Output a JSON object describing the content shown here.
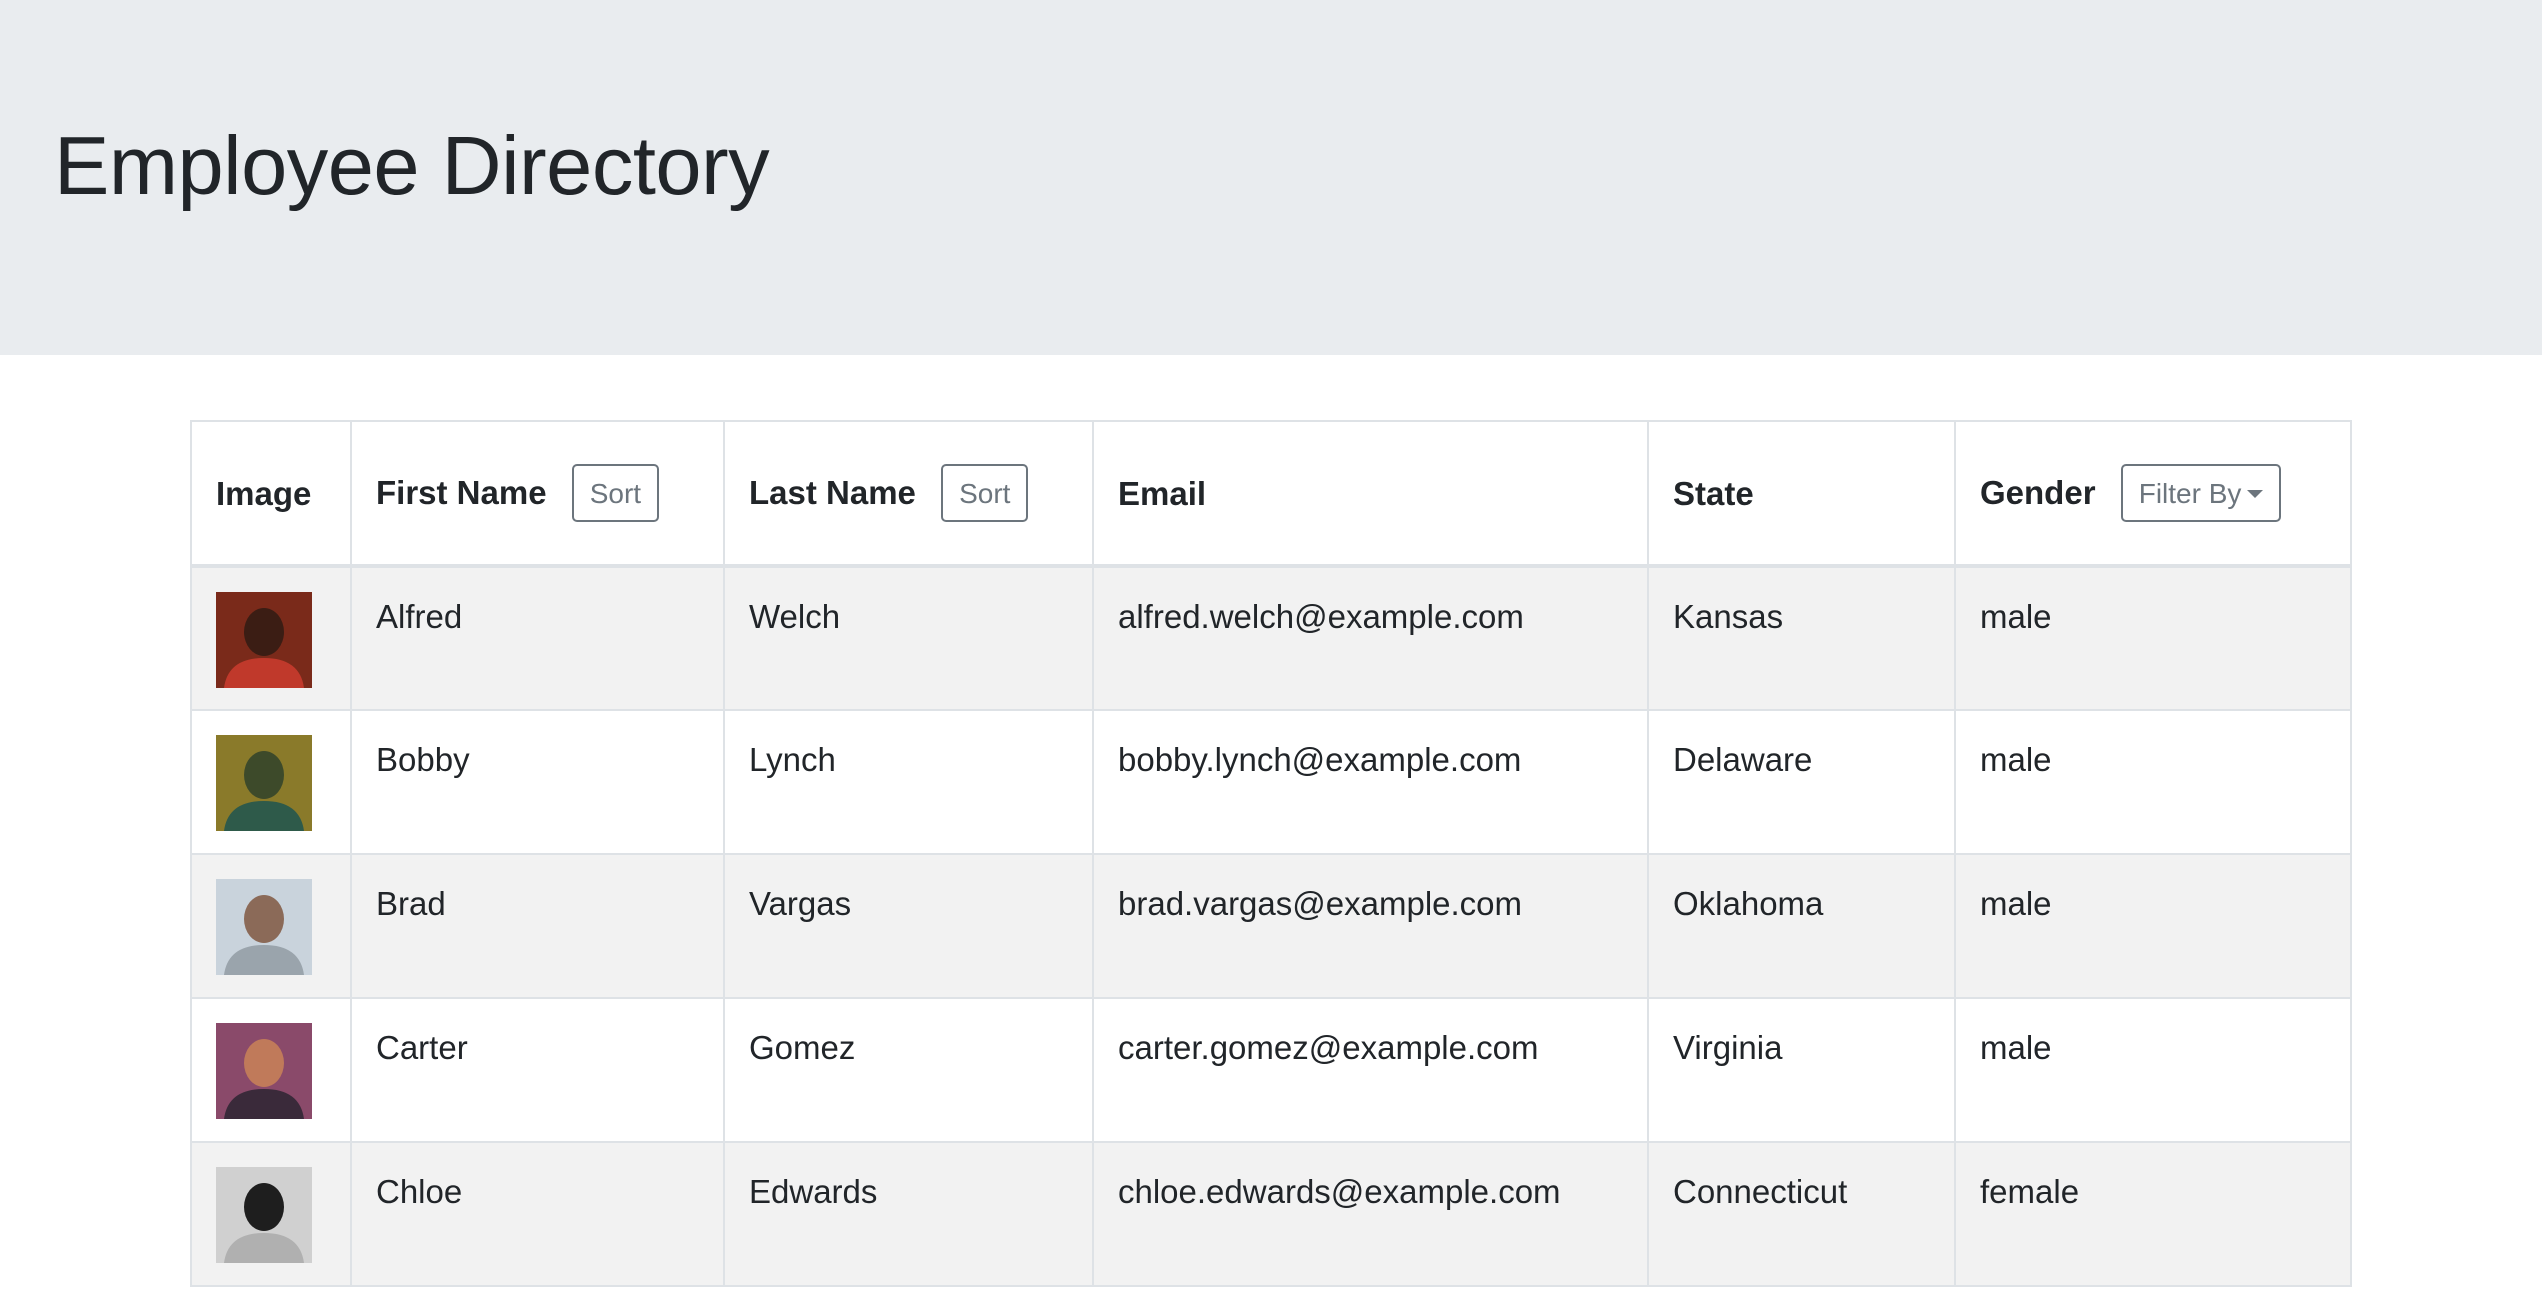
{
  "header": {
    "title": "Employee Directory"
  },
  "table": {
    "columns": {
      "image": "Image",
      "first_name": "First Name",
      "last_name": "Last Name",
      "email": "Email",
      "state": "State",
      "gender": "Gender"
    },
    "sort_label": "Sort",
    "filter_label": "Filter By",
    "rows": [
      {
        "first": "Alfred",
        "last": "Welch",
        "email": "alfred.welch@example.com",
        "state": "Kansas",
        "gender": "male",
        "avatar_colors": [
          "#7a2a1a",
          "#3b1d14",
          "#c0392b"
        ]
      },
      {
        "first": "Bobby",
        "last": "Lynch",
        "email": "bobby.lynch@example.com",
        "state": "Delaware",
        "gender": "male",
        "avatar_colors": [
          "#8a7a2a",
          "#3d4a2a",
          "#2e5a4a"
        ]
      },
      {
        "first": "Brad",
        "last": "Vargas",
        "email": "brad.vargas@example.com",
        "state": "Oklahoma",
        "gender": "male",
        "avatar_colors": [
          "#c9d3dc",
          "#8b6a58",
          "#9aa4ac"
        ]
      },
      {
        "first": "Carter",
        "last": "Gomez",
        "email": "carter.gomez@example.com",
        "state": "Virginia",
        "gender": "male",
        "avatar_colors": [
          "#8a4a6a",
          "#c07a5a",
          "#3a2a3a"
        ]
      },
      {
        "first": "Chloe",
        "last": "Edwards",
        "email": "chloe.edwards@example.com",
        "state": "Connecticut",
        "gender": "female",
        "avatar_colors": [
          "#d0d0d0",
          "#1e1e1e",
          "#b0b0b0"
        ]
      }
    ]
  }
}
